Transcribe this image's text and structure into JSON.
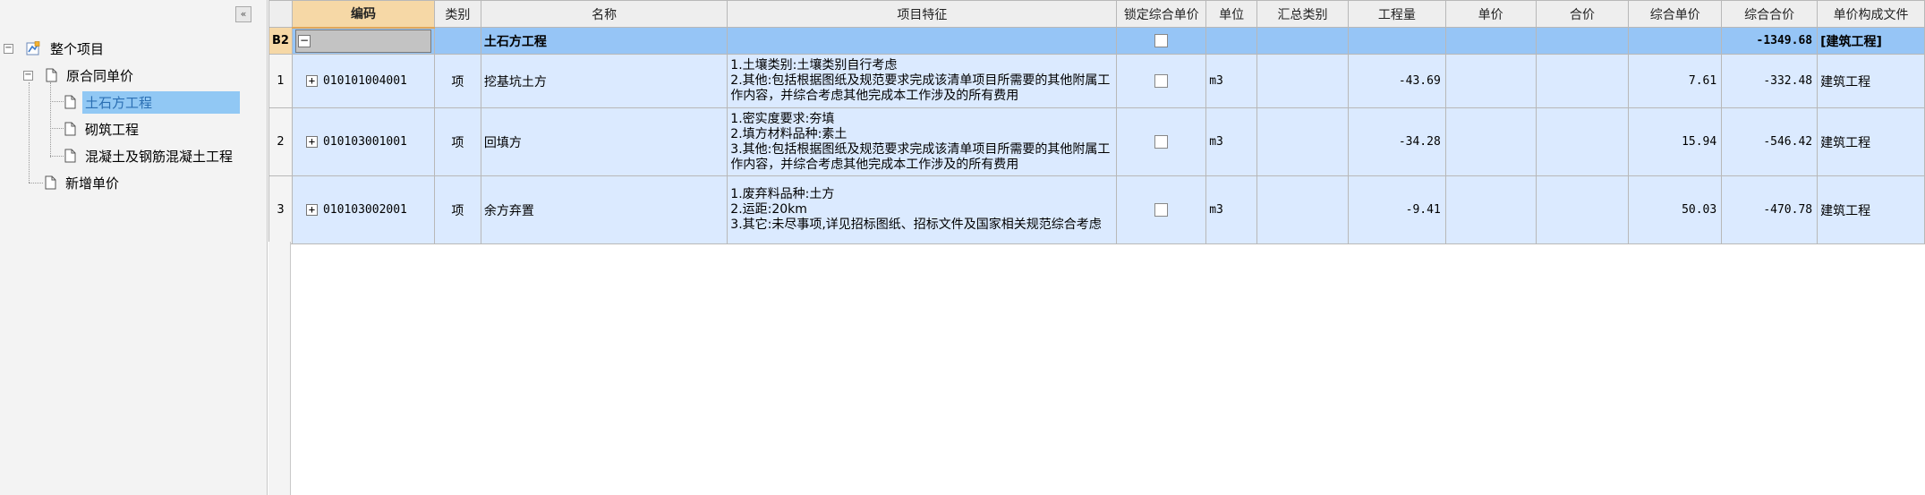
{
  "sidebar": {
    "collapse_label": "«",
    "tree": {
      "root": "整个项目",
      "group": "原合同单价",
      "children": [
        "土石方工程",
        "砌筑工程",
        "混凝土及钢筋混凝土工程"
      ],
      "extra": "新增单价"
    }
  },
  "grid": {
    "columns": [
      "编码",
      "类别",
      "名称",
      "项目特征",
      "锁定综合单价",
      "单位",
      "汇总类别",
      "工程量",
      "单价",
      "合价",
      "综合单价",
      "综合合价",
      "单价构成文件"
    ],
    "group_row": {
      "rownum": "B2",
      "toggle": "−",
      "name": "土石方工程",
      "total": "-1349.68",
      "file": "[建筑工程]"
    },
    "rows": [
      {
        "rownum": "1",
        "code": "010101004001",
        "category": "项",
        "name": "挖基坑土方",
        "features": "1.土壤类别:土壤类别自行考虑\n2.其他:包括根据图纸及规范要求完成该清单项目所需要的其他附属工作内容，并综合考虑其他完成本工作涉及的所有费用",
        "unit": "m3",
        "quantity": "-43.69",
        "unit_price": "",
        "total_price": "",
        "comp_price": "7.61",
        "comp_total": "-332.48",
        "file": "建筑工程"
      },
      {
        "rownum": "2",
        "code": "010103001001",
        "category": "项",
        "name": "回填方",
        "features": "1.密实度要求:夯填\n2.填方材料品种:素土\n3.其他:包括根据图纸及规范要求完成该清单项目所需要的其他附属工作内容，并综合考虑其他完成本工作涉及的所有费用",
        "unit": "m3",
        "quantity": "-34.28",
        "unit_price": "",
        "total_price": "",
        "comp_price": "15.94",
        "comp_total": "-546.42",
        "file": "建筑工程"
      },
      {
        "rownum": "3",
        "code": "010103002001",
        "category": "项",
        "name": "余方弃置",
        "features": "1.废弃料品种:土方\n2.运距:20km\n3.其它:未尽事项,详见招标图纸、招标文件及国家相关规范综合考虑",
        "unit": "m3",
        "quantity": "-9.41",
        "unit_price": "",
        "total_price": "",
        "comp_price": "50.03",
        "comp_total": "-470.78",
        "file": "建筑工程"
      }
    ]
  },
  "icons": {
    "project": "project-tree-icon",
    "document": "document-icon",
    "expand": "plus-icon",
    "collapse": "minus-icon"
  },
  "colors": {
    "row_bg": "#dbeaff",
    "group_bg": "#96c5f6",
    "selected_bg": "#91c8f4",
    "code_header_bg": "#f6d8a6"
  }
}
